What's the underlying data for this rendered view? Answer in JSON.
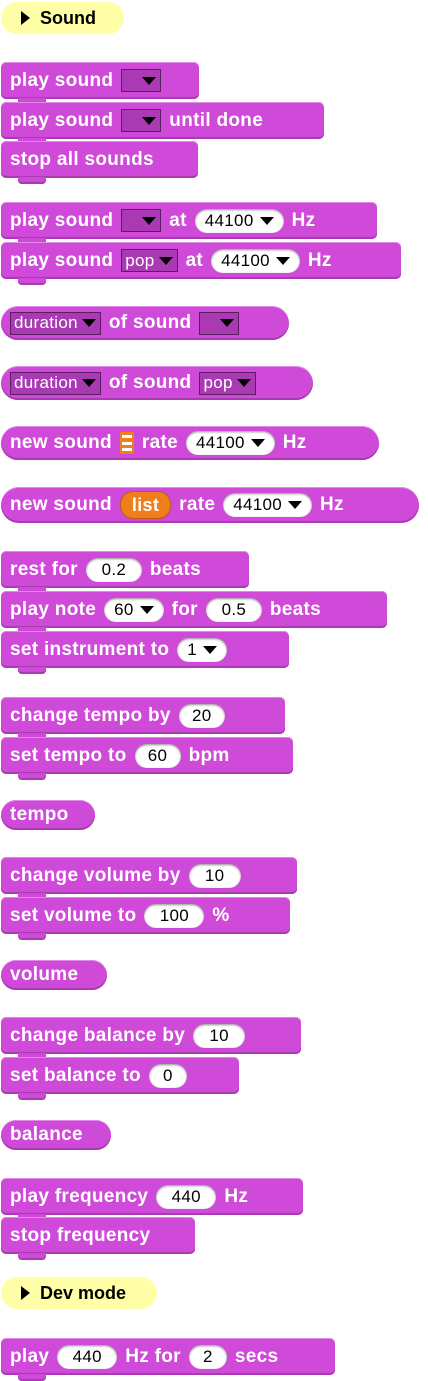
{
  "categories": {
    "sound": "Sound",
    "dev_mode": "Dev mode"
  },
  "blocks": {
    "play_sound": {
      "label": "play sound"
    },
    "play_sound_until": {
      "label": "play sound",
      "suffix": "until done"
    },
    "stop_all_sounds": {
      "label": "stop all sounds"
    },
    "play_sound_at": {
      "label": "play sound",
      "at": "at",
      "rate": "44100",
      "unit": "Hz"
    },
    "play_sound_pop_at": {
      "label": "play sound",
      "sound": "pop",
      "at": "at",
      "rate": "44100",
      "unit": "Hz"
    },
    "duration_of_sound": {
      "attr": "duration",
      "label": "of sound"
    },
    "duration_of_sound_pop": {
      "attr": "duration",
      "label": "of sound",
      "sound": "pop"
    },
    "new_sound": {
      "label": "new sound",
      "rate_label": "rate",
      "rate": "44100",
      "unit": "Hz"
    },
    "new_sound_list": {
      "label": "new sound",
      "list": "list",
      "rate_label": "rate",
      "rate": "44100",
      "unit": "Hz"
    },
    "rest_for": {
      "label": "rest for",
      "value": "0.2",
      "unit": "beats"
    },
    "play_note": {
      "label": "play note",
      "note": "60",
      "for": "for",
      "value": "0.5",
      "unit": "beats"
    },
    "set_instrument": {
      "label": "set instrument to",
      "value": "1"
    },
    "change_tempo": {
      "label": "change tempo by",
      "value": "20"
    },
    "set_tempo": {
      "label": "set tempo to",
      "value": "60",
      "unit": "bpm"
    },
    "tempo": {
      "label": "tempo"
    },
    "change_volume": {
      "label": "change volume by",
      "value": "10"
    },
    "set_volume": {
      "label": "set volume to",
      "value": "100",
      "unit": "%"
    },
    "volume": {
      "label": "volume"
    },
    "change_balance": {
      "label": "change balance by",
      "value": "10"
    },
    "set_balance": {
      "label": "set balance to",
      "value": "0"
    },
    "balance": {
      "label": "balance"
    },
    "play_frequency": {
      "label": "play frequency",
      "value": "440",
      "unit": "Hz"
    },
    "stop_frequency": {
      "label": "stop frequency"
    },
    "play_hz_for": {
      "label": "play",
      "value": "440",
      "mid": "Hz for",
      "secs": "2",
      "unit": "secs"
    }
  },
  "colors": {
    "sound_block": "#cf4ad9",
    "category_bg": "#ffffa8",
    "list_reporter": "#f07e1d"
  }
}
